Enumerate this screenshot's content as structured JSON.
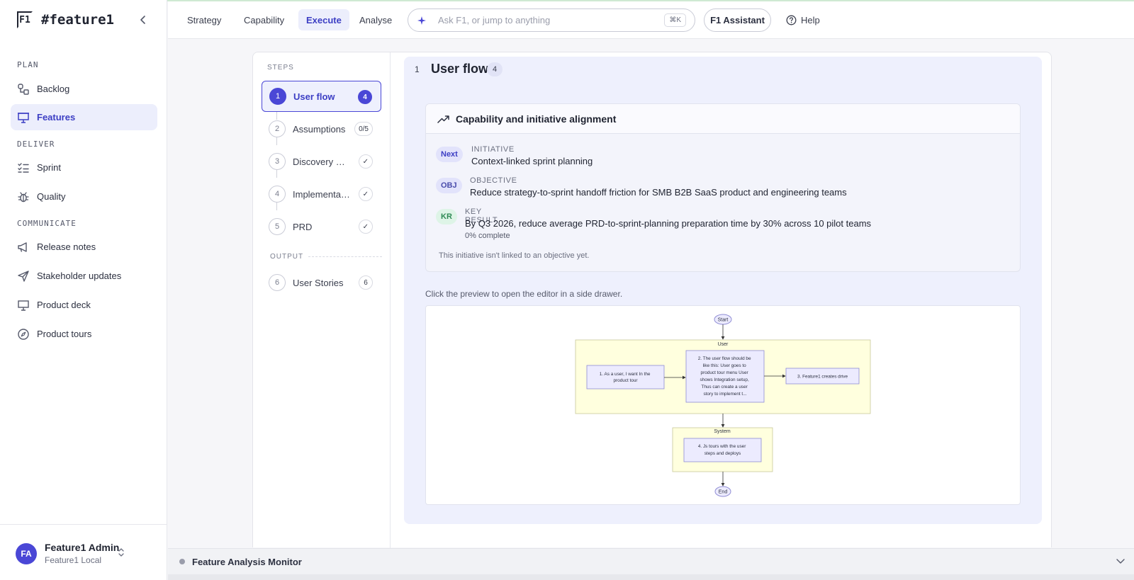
{
  "app": {
    "logo": "F1",
    "workspace": "#feature1"
  },
  "sidebar": {
    "sections": [
      {
        "label": "PLAN",
        "items": [
          {
            "label": "Backlog",
            "icon": "backlog-icon"
          },
          {
            "label": "Features",
            "icon": "presentation-icon",
            "active": true
          }
        ]
      },
      {
        "label": "DELIVER",
        "items": [
          {
            "label": "Sprint",
            "icon": "checklist-icon"
          },
          {
            "label": "Quality",
            "icon": "bug-icon"
          }
        ]
      },
      {
        "label": "COMMUNICATE",
        "items": [
          {
            "label": "Release notes",
            "icon": "megaphone-icon"
          },
          {
            "label": "Stakeholder updates",
            "icon": "send-icon"
          },
          {
            "label": "Product deck",
            "icon": "monitor-icon"
          },
          {
            "label": "Product tours",
            "icon": "compass-icon"
          }
        ]
      }
    ],
    "user": {
      "initials": "FA",
      "name": "Feature1 Admin",
      "org": "Feature1 Local"
    }
  },
  "topbar": {
    "tabs": [
      {
        "label": "Strategy"
      },
      {
        "label": "Capability"
      },
      {
        "label": "Execute",
        "active": true
      },
      {
        "label": "Analyse"
      }
    ],
    "search": {
      "placeholder": "Ask F1, or jump to anything",
      "shortcut": "⌘K"
    },
    "assistant_label": "F1 Assistant",
    "help_label": "Help"
  },
  "steps": {
    "heading": "STEPS",
    "items": [
      {
        "num": "1",
        "label": "User flow",
        "badge": "4",
        "active": true
      },
      {
        "num": "2",
        "label": "Assumptions",
        "badge": "0/5"
      },
      {
        "num": "3",
        "label": "Discovery & Research",
        "badge": "✓"
      },
      {
        "num": "4",
        "label": "Implementation",
        "badge": "✓"
      },
      {
        "num": "5",
        "label": "PRD",
        "badge": "✓"
      }
    ],
    "output_heading": "OUTPUT",
    "output_items": [
      {
        "num": "6",
        "label": "User Stories",
        "badge": "6"
      }
    ]
  },
  "content": {
    "step_num": "1",
    "title": "User flow",
    "count": "4",
    "alignment": {
      "heading": "Capability and initiative alignment",
      "initiative": {
        "pill": "Next",
        "kicker": "INITIATIVE",
        "text": "Context-linked sprint planning"
      },
      "objective": {
        "pill": "OBJ",
        "kicker": "OBJECTIVE",
        "text": "Reduce strategy-to-sprint handoff friction for SMB B2B SaaS product and engineering teams"
      },
      "key_result": {
        "pill": "KR",
        "kicker": "KEY RESULT",
        "text": "By Q3 2026, reduce average PRD-to-sprint-planning preparation time by 30% across 10 pilot teams",
        "progress": "0% complete"
      },
      "note": "This initiative isn't linked to an objective yet."
    },
    "preview_hint": "Click the preview to open the editor in a side drawer.",
    "flow": {
      "start": "Start",
      "end": "End",
      "lane_user": "User",
      "lane_system": "System",
      "node1": [
        "1. As a user, I want In the",
        "product tour"
      ],
      "node2": [
        "2. The user flow should be",
        "like this: User goes to",
        "product tour menu User",
        "shows Integration setup,",
        "Thus can create a user",
        "story to implement t..."
      ],
      "node3": [
        "3. Feature1 creates drive"
      ],
      "node4": [
        "4. Js tours with the user",
        "steps and deploys"
      ]
    }
  },
  "monitor": {
    "title": "Feature Analysis Monitor"
  }
}
